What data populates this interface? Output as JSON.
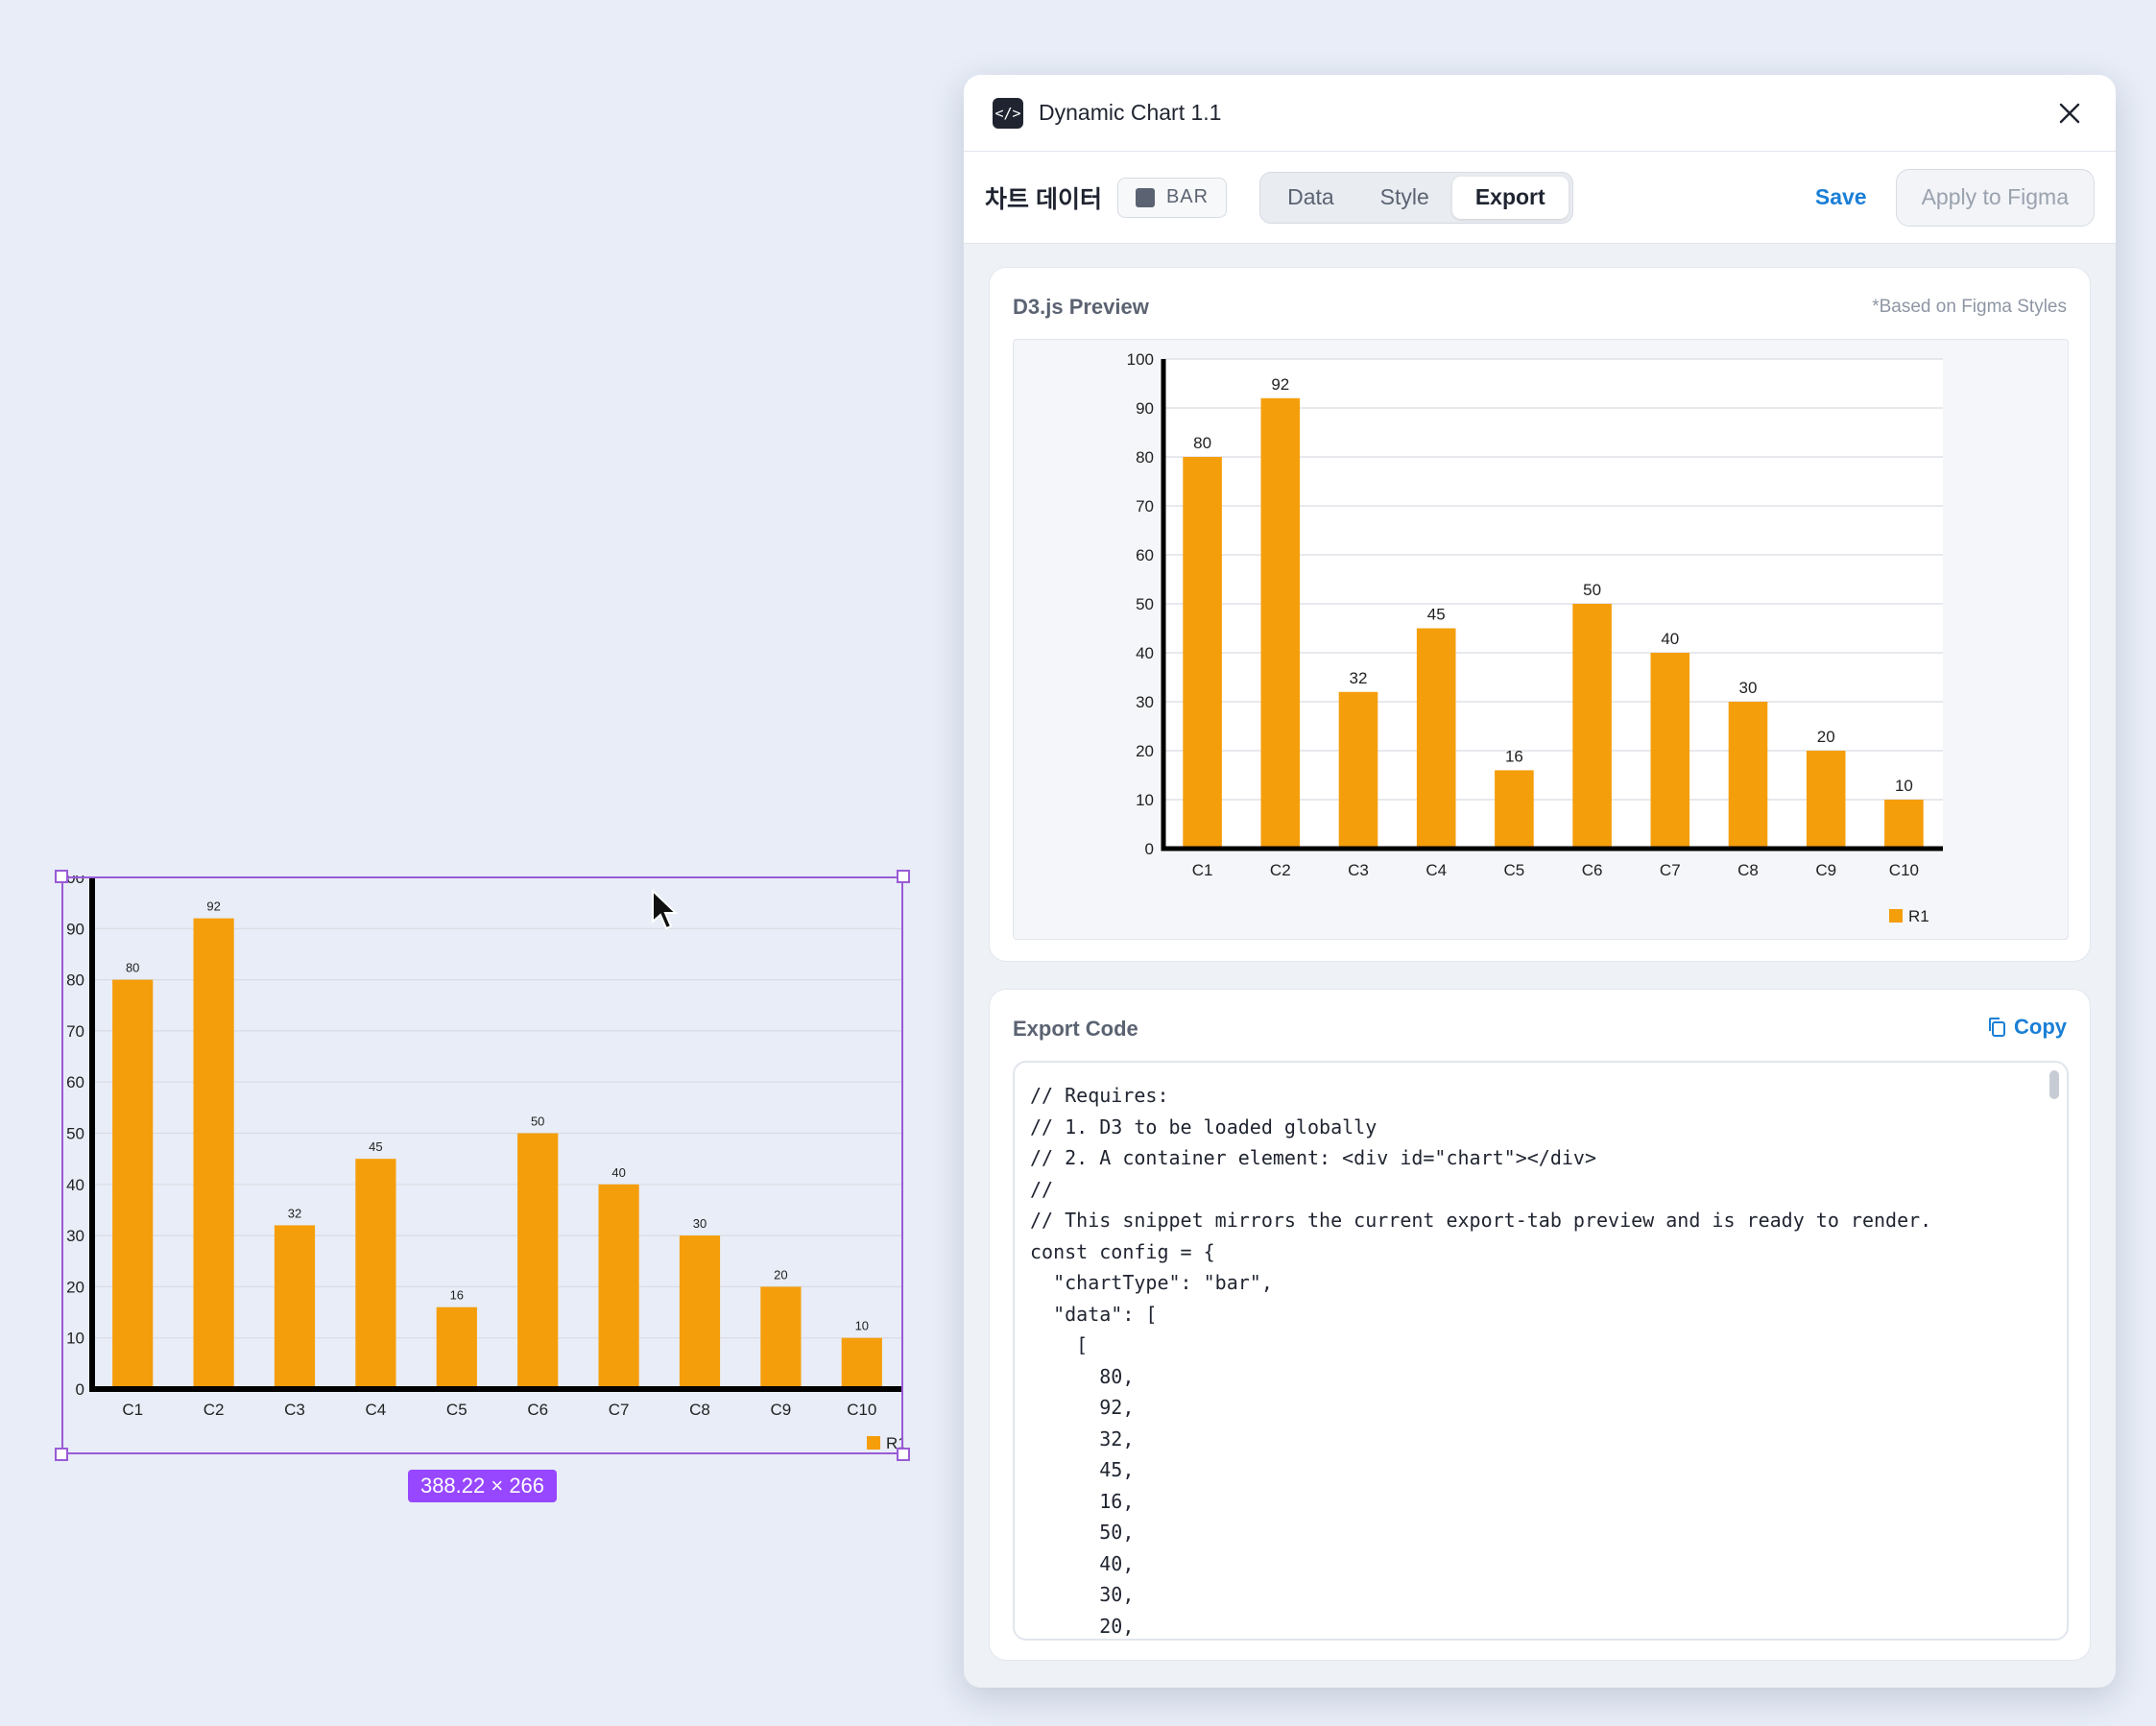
{
  "canvas": {
    "size_badge": "388.22 × 266"
  },
  "panel": {
    "app_title": "Dynamic Chart 1.1",
    "app_icon": "code-icon",
    "toolbar": {
      "label": "차트 데이터",
      "chart_type": "BAR",
      "tabs": [
        "Data",
        "Style",
        "Export"
      ],
      "active_tab": "Export",
      "save_label": "Save",
      "apply_label": "Apply to Figma"
    },
    "preview": {
      "title": "D3.js Preview",
      "note": "*Based on Figma Styles"
    },
    "export": {
      "title": "Export Code",
      "copy_label": "Copy",
      "code": "// Requires:\n// 1. D3 to be loaded globally\n// 2. A container element: <div id=\"chart\"></div>\n//\n// This snippet mirrors the current export-tab preview and is ready to render.\nconst config = {\n  \"chartType\": \"bar\",\n  \"data\": [\n    [\n      80,\n      92,\n      32,\n      45,\n      16,\n      50,\n      40,\n      30,\n      20,"
    }
  },
  "colors": {
    "bar": "#f59e0b",
    "accent": "#1a7fd6",
    "selection": "#9747ff"
  },
  "chart_data": [
    {
      "type": "bar",
      "categories": [
        "C1",
        "C2",
        "C3",
        "C4",
        "C5",
        "C6",
        "C7",
        "C8",
        "C9",
        "C10"
      ],
      "series": [
        {
          "name": "R1",
          "values": [
            80,
            92,
            32,
            45,
            16,
            50,
            40,
            30,
            20,
            10
          ]
        }
      ],
      "ylim": [
        0,
        100
      ],
      "yticks": [
        0,
        10,
        20,
        30,
        40,
        50,
        60,
        70,
        80,
        90,
        100
      ],
      "grid": true,
      "legend": "bottom-right",
      "title": "",
      "xlabel": "",
      "ylabel": ""
    },
    {
      "type": "bar",
      "categories": [
        "C1",
        "C2",
        "C3",
        "C4",
        "C5",
        "C6",
        "C7",
        "C8",
        "C9",
        "C10"
      ],
      "series": [
        {
          "name": "R1",
          "values": [
            80,
            92,
            32,
            45,
            16,
            50,
            40,
            30,
            20,
            10
          ]
        }
      ],
      "ylim": [
        0,
        100
      ],
      "yticks": [
        0,
        10,
        20,
        30,
        40,
        50,
        60,
        70,
        80,
        90,
        100
      ],
      "grid": true,
      "legend": "bottom-right",
      "title": "",
      "xlabel": "",
      "ylabel": ""
    }
  ]
}
